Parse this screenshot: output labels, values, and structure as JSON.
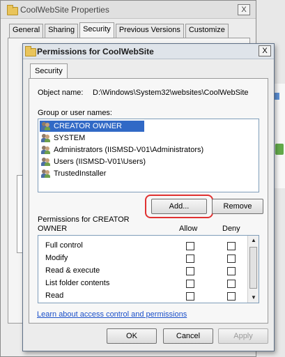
{
  "background_window": {
    "title": "CoolWebSite Properties",
    "close": "X",
    "tabs": [
      "General",
      "Sharing",
      "Security",
      "Previous Versions",
      "Customize"
    ],
    "active_tab": "Security"
  },
  "dialog": {
    "title": "Permissions for CoolWebSite",
    "close": "X",
    "tab": "Security",
    "object_name_label": "Object name:",
    "object_name_value": "D:\\Windows\\System32\\websites\\CoolWebSite",
    "group_label": "Group or user names:",
    "users": [
      {
        "name": "CREATOR OWNER",
        "selected": true
      },
      {
        "name": "SYSTEM",
        "selected": false
      },
      {
        "name": "Administrators (IISMSD-V01\\Administrators)",
        "selected": false
      },
      {
        "name": "Users (IISMSD-V01\\Users)",
        "selected": false
      },
      {
        "name": "TrustedInstaller",
        "selected": false
      }
    ],
    "add_button": "Add...",
    "remove_button": "Remove",
    "permissions_label_line1": "Permissions for CREATOR",
    "permissions_label_line2": "OWNER",
    "allow_header": "Allow",
    "deny_header": "Deny",
    "permissions": [
      {
        "name": "Full control",
        "allow": false,
        "deny": false
      },
      {
        "name": "Modify",
        "allow": false,
        "deny": false
      },
      {
        "name": "Read & execute",
        "allow": false,
        "deny": false
      },
      {
        "name": "List folder contents",
        "allow": false,
        "deny": false
      },
      {
        "name": "Read",
        "allow": false,
        "deny": false
      }
    ],
    "learn_link": "Learn about access control and permissions",
    "ok_button": "OK",
    "cancel_button": "Cancel",
    "apply_button": "Apply"
  },
  "colors": {
    "highlight_ring": "#e03131",
    "selection": "#3169c6",
    "link": "#1a4fc9"
  }
}
